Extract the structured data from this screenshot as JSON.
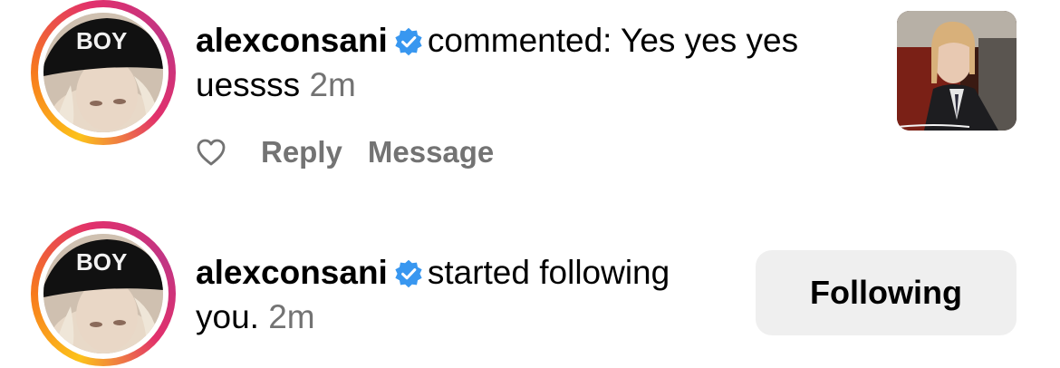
{
  "notifications": [
    {
      "username": "alexconsani",
      "action": "commented: Yes yes yes uessss",
      "time": "2m",
      "actions": {
        "reply": "Reply",
        "message": "Message"
      },
      "avatar_cap_text": "BOY"
    },
    {
      "username": "alexconsani",
      "action": "started following you.",
      "time": "2m",
      "button_label": "Following",
      "avatar_cap_text": "BOY"
    }
  ],
  "colors": {
    "verified": "#3897f0",
    "secondary_text": "#737373",
    "button_bg": "#efefef"
  },
  "icons": [
    "verified-badge-icon",
    "heart-icon"
  ]
}
